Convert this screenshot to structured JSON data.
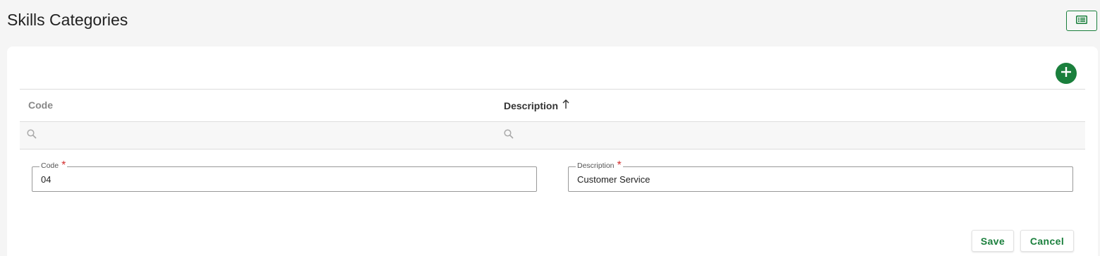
{
  "header": {
    "title": "Skills Categories",
    "view_toggle_icon": "list-view-icon"
  },
  "grid": {
    "add_icon": "plus-icon",
    "columns": [
      {
        "label": "Code",
        "sorted": false
      },
      {
        "label": "Description",
        "sorted": true,
        "sort_direction": "ascending",
        "sort_icon": "arrow-up-icon"
      }
    ],
    "filter_icon": "search-icon"
  },
  "form": {
    "code": {
      "label": "Code",
      "required_mark": "*",
      "value": "04"
    },
    "description": {
      "label": "Description",
      "required_mark": "*",
      "value": "Customer Service"
    }
  },
  "actions": {
    "save_label": "Save",
    "cancel_label": "Cancel"
  },
  "colors": {
    "accent": "#1a7f3c",
    "required": "#d32f2f",
    "background": "#f5f5f5"
  }
}
